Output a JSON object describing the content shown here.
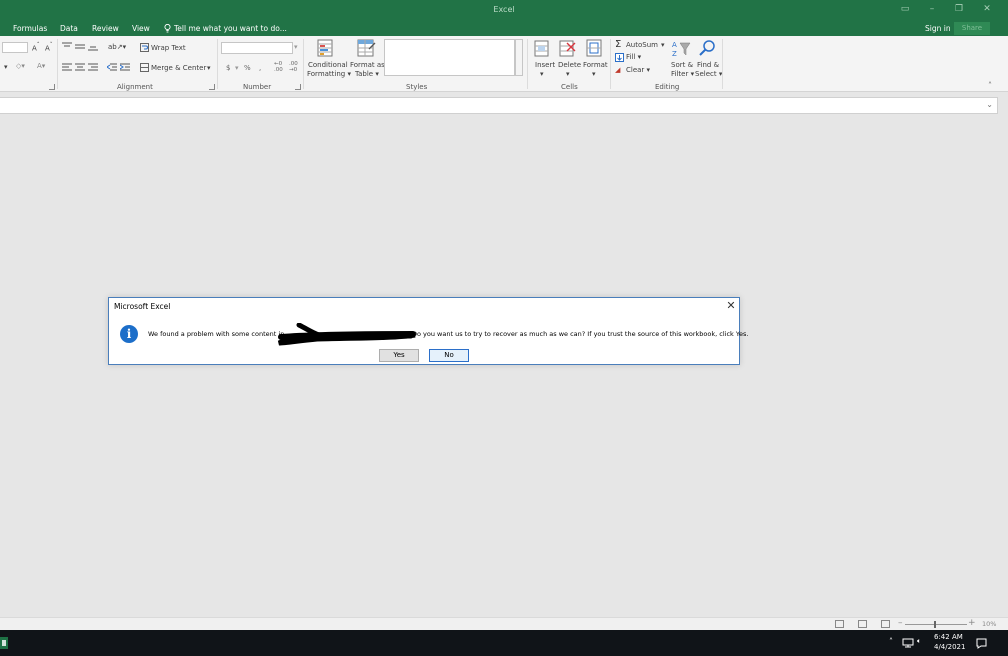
{
  "window": {
    "title": "Excel"
  },
  "tabs": [
    "Formulas",
    "Data",
    "Review",
    "View"
  ],
  "tell_me": "Tell me what you want to do...",
  "account": {
    "sign_in": "Sign in",
    "share": "Share"
  },
  "ribbon": {
    "alignment": {
      "wrap_text": "Wrap Text",
      "merge_center": "Merge & Center",
      "group_label": "Alignment"
    },
    "number": {
      "currency": "$",
      "percent": "%",
      "comma": ",",
      "group_label": "Number"
    },
    "styles": {
      "conditional_1": "Conditional",
      "conditional_2": "Formatting",
      "format_table_1": "Format as",
      "format_table_2": "Table",
      "group_label": "Styles"
    },
    "cells": {
      "insert": "Insert",
      "delete": "Delete",
      "format": "Format",
      "group_label": "Cells"
    },
    "editing": {
      "autosum": "AutoSum",
      "fill": "Fill",
      "clear": "Clear",
      "sort_1": "Sort &",
      "sort_2": "Filter",
      "find_1": "Find &",
      "find_2": "Select",
      "group_label": "Editing"
    }
  },
  "dialog": {
    "title": "Microsoft Excel",
    "message_start": "We found a problem with some content in",
    "message_end": "Do you want us to try to recover as much as we can? If you trust the source of this workbook, click Yes.",
    "yes_label": "Yes",
    "no_label": "No"
  },
  "statusbar": {
    "zoom": "10%"
  },
  "taskbar": {
    "time": "6:42 AM",
    "date": "4/4/2021"
  },
  "colors": {
    "excel_green": "#217346",
    "info_blue": "#1c6ec9",
    "taskbar": "#101418"
  }
}
